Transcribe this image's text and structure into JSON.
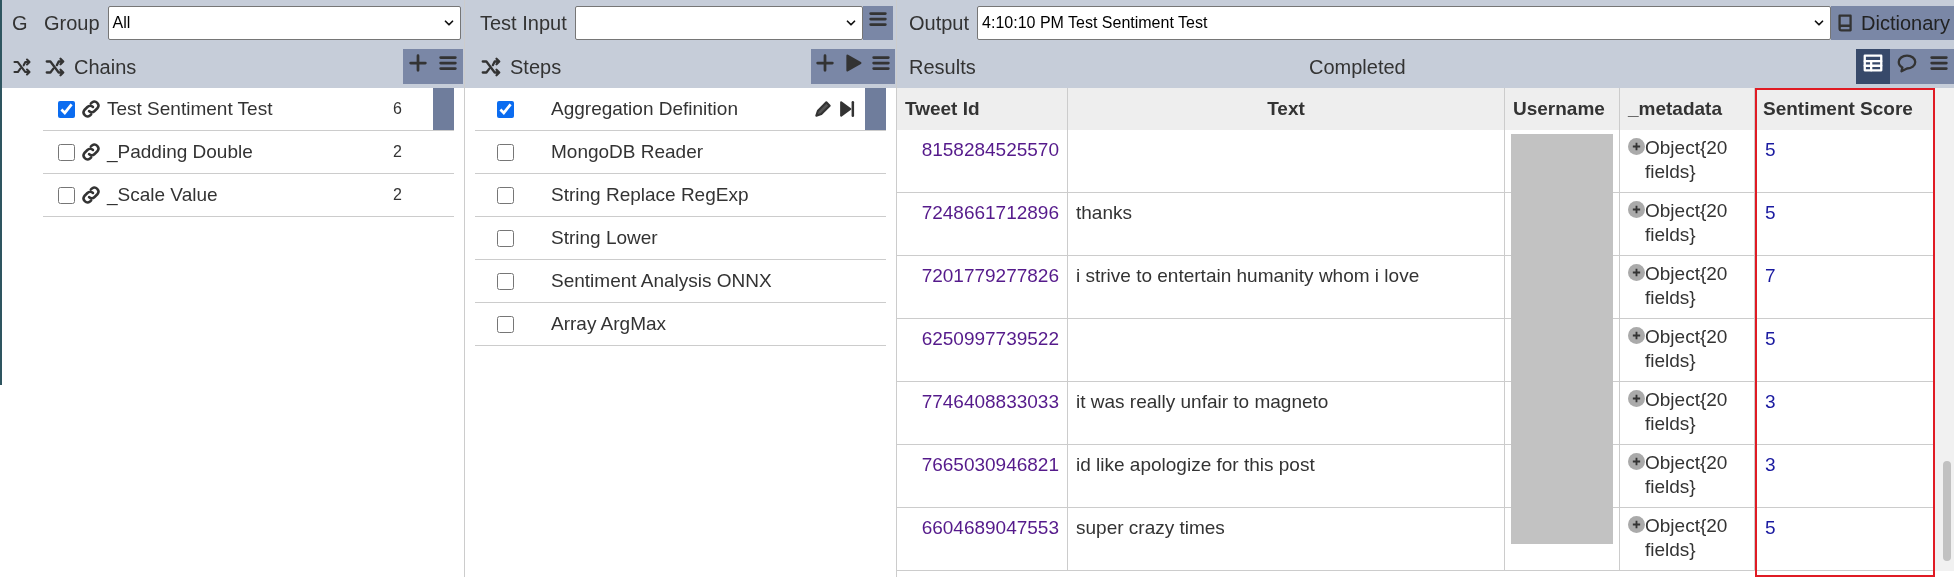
{
  "background_panel": {
    "title": "G"
  },
  "chains_panel": {
    "group_label": "Group",
    "group_value": "All",
    "title": "Chains",
    "items": [
      {
        "label": "Test Sentiment Test",
        "count": "6",
        "checked": true,
        "selected": true
      },
      {
        "label": "_Padding Double",
        "count": "2",
        "checked": false,
        "selected": false
      },
      {
        "label": "_Scale Value",
        "count": "2",
        "checked": false,
        "selected": false
      }
    ]
  },
  "steps_panel": {
    "test_input_label": "Test Input",
    "title": "Steps",
    "items": [
      {
        "label": "Aggregation Definition",
        "checked": true,
        "selected": true
      },
      {
        "label": "MongoDB Reader",
        "checked": false,
        "selected": false
      },
      {
        "label": "String Replace RegExp",
        "checked": false,
        "selected": false
      },
      {
        "label": "String Lower",
        "checked": false,
        "selected": false
      },
      {
        "label": "Sentiment Analysis ONNX",
        "checked": false,
        "selected": false
      },
      {
        "label": "Array ArgMax",
        "checked": false,
        "selected": false
      }
    ]
  },
  "output_panel": {
    "output_label": "Output",
    "output_value": "4:10:10 PM Test Sentiment Test",
    "dictionary_button": "Dictionary",
    "results_title": "Results",
    "status": "Completed",
    "view_modes": [
      {
        "kind": "table",
        "selected": true
      },
      {
        "kind": "chat",
        "selected": false
      }
    ],
    "table": {
      "columns": [
        {
          "label": "Tweet Id",
          "highlighted": false
        },
        {
          "label": "Text",
          "highlighted": false
        },
        {
          "label": "Username",
          "highlighted": false
        },
        {
          "label": "_metadata",
          "highlighted": false
        },
        {
          "label": "Sentiment Score",
          "highlighted": true
        }
      ],
      "rows": [
        {
          "tweet_id": "8158284525570",
          "text": "",
          "metadata": "Object{20 fields}",
          "sentiment_score": "5"
        },
        {
          "tweet_id": "7248661712896",
          "text": "thanks",
          "metadata": "Object{20 fields}",
          "sentiment_score": "5"
        },
        {
          "tweet_id": "7201779277826",
          "text": "i strive to entertain humanity whom i love",
          "metadata": "Object{20 fields}",
          "sentiment_score": "7"
        },
        {
          "tweet_id": "6250997739522",
          "text": "",
          "metadata": "Object{20 fields}",
          "sentiment_score": "5"
        },
        {
          "tweet_id": "7746408833033",
          "text": "it was really unfair to magneto",
          "metadata": "Object{20 fields}",
          "sentiment_score": "3"
        },
        {
          "tweet_id": "7665030946821",
          "text": "id like apologize for this post",
          "metadata": "Object{20 fields}",
          "sentiment_score": "3"
        },
        {
          "tweet_id": "6604689047553",
          "text": "super crazy times",
          "metadata": "Object{20 fields}",
          "sentiment_score": "5"
        }
      ]
    }
  }
}
